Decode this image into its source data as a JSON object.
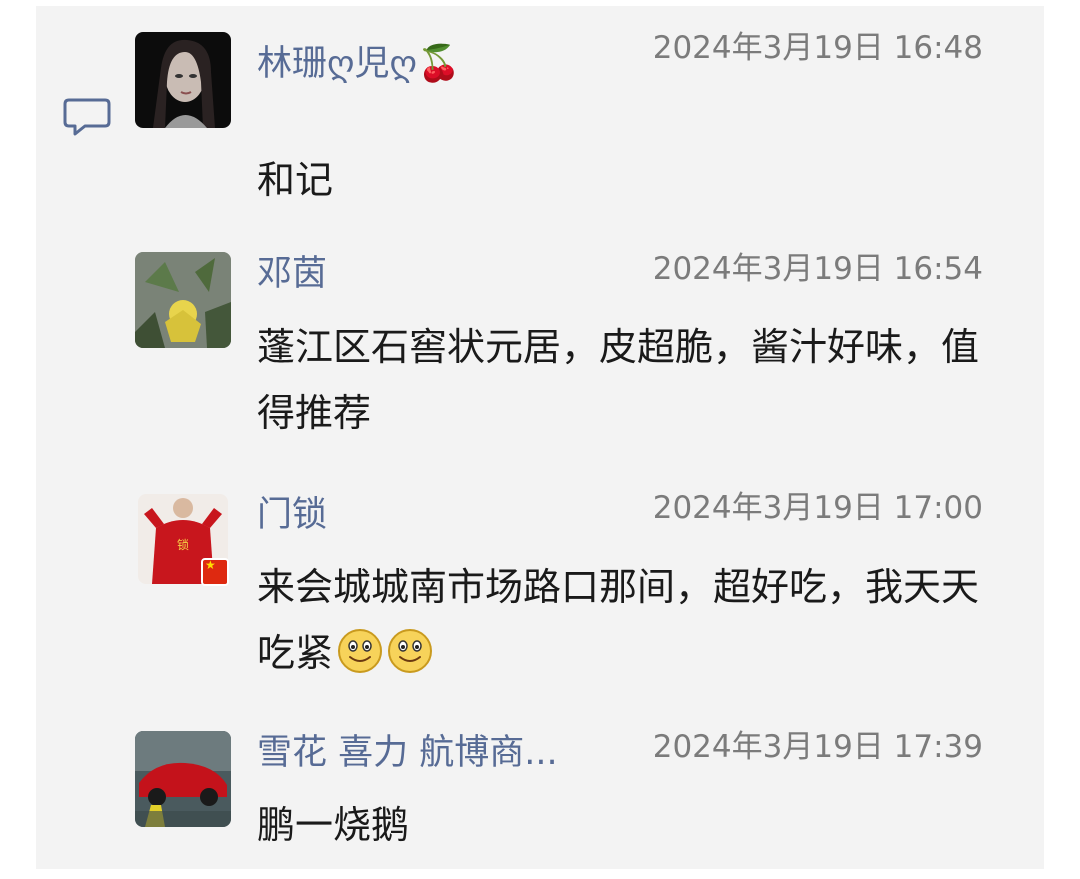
{
  "comments": [
    {
      "name": "林珊ღ児ღ🍒",
      "time": "2024年3月19日 16:48",
      "text": "和记"
    },
    {
      "name": "邓茵",
      "time": "2024年3月19日 16:54",
      "text": "蓬江区石窖状元居，皮超脆，酱汁好味，值得推荐"
    },
    {
      "name": "门锁",
      "time": "2024年3月19日 17:00",
      "text": "来会城城南市场路口那间，超好吃，我天天吃紧"
    },
    {
      "name": "雪花 喜力 航博商...",
      "time": "2024年3月19日 17:39",
      "text": "鹏一烧鹅"
    }
  ],
  "icons": {
    "comment": "comment-bubble-icon",
    "smile": "smile-emoji-icon"
  },
  "colors": {
    "name": "#576b95",
    "time": "#7b7b7b",
    "text": "#1a1a1a",
    "panel": "#f3f3f3"
  }
}
